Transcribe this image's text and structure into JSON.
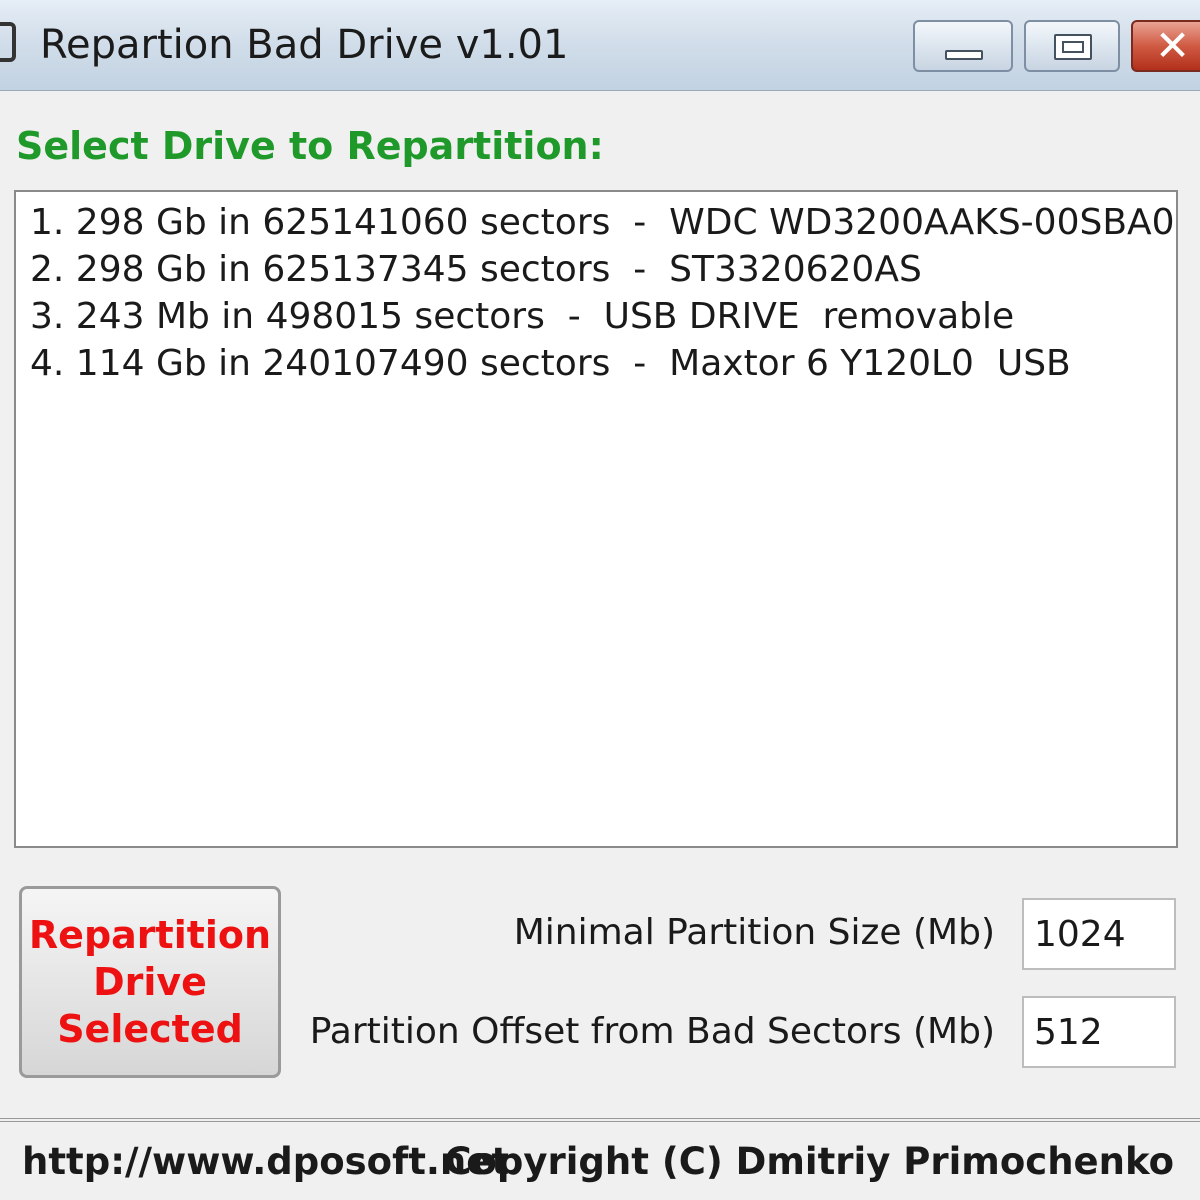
{
  "window": {
    "title": "Repartion Bad Drive v1.01",
    "icon": "app-drive-icon",
    "controls": {
      "minimize": "minimize-icon",
      "maximize": "maximize-icon",
      "close": "close-icon"
    }
  },
  "drive_section": {
    "label": "Select Drive to Repartition:",
    "drives": [
      "1. 298 Gb in 625141060 sectors  -  WDC WD3200AAKS-00SBA0",
      "2. 298 Gb in 625137345 sectors  -  ST3320620AS",
      "3. 243 Mb in 498015 sectors  -  USB DRIVE  removable",
      "4. 114 Gb in 240107490 sectors  -  Maxtor 6 Y120L0  USB"
    ]
  },
  "actions": {
    "repartition_label": "Repartition\nDrive\nSelected"
  },
  "settings": {
    "min_size_label": "Minimal Partition Size (Mb)",
    "min_size_value": "1024",
    "offset_label": "Partition Offset from Bad Sectors (Mb)",
    "offset_value": "512"
  },
  "footer": {
    "url": "http://www.dposoft.net",
    "copyright": "Copyright (C) Dmitriy Primochenko"
  },
  "colors": {
    "heading_green": "#1f9a2a",
    "action_red": "#ee1111"
  }
}
